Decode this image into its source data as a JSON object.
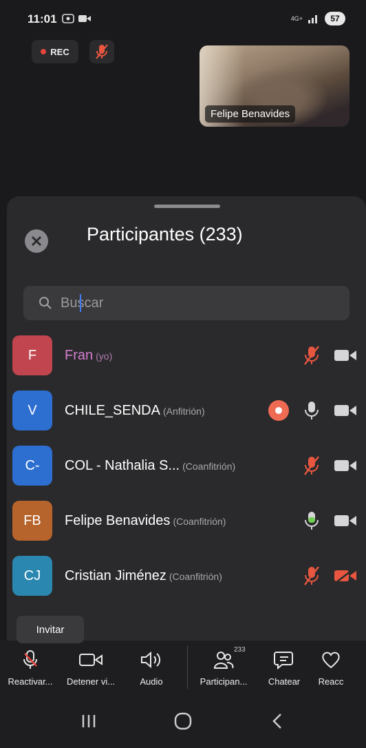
{
  "status_bar": {
    "time": "11:01",
    "battery": "57",
    "network": "4G+"
  },
  "meeting": {
    "rec_label": "REC",
    "video_tile_name": "Felipe Benavides"
  },
  "participants_panel": {
    "title": "Participantes (233)",
    "search_placeholder": "Buscar",
    "participants": [
      {
        "initials": "F",
        "name": "Fran",
        "role": "(yo)",
        "avatar_color": "#c0454f",
        "mic": "muted",
        "video": "on",
        "recording": false
      },
      {
        "initials": "V",
        "name": "CHILE_SENDA",
        "role": "(Anfitrión)",
        "avatar_color": "#2d6fd1",
        "mic": "on",
        "video": "on",
        "recording": true
      },
      {
        "initials": "C-",
        "name": "COL - Nathalia S...",
        "role": "(Coanfitrión)",
        "avatar_color": "#2d6fd1",
        "mic": "muted",
        "video": "on",
        "recording": false
      },
      {
        "initials": "FB",
        "name": "Felipe Benavides",
        "role": "(Coanfitrión)",
        "avatar_color": "#b7642c",
        "mic": "speaking",
        "video": "on",
        "recording": false
      },
      {
        "initials": "CJ",
        "name": "Cristian Jiménez",
        "role": "(Coanfitrión)",
        "avatar_color": "#2a87b0",
        "mic": "muted",
        "video": "off",
        "recording": false
      }
    ],
    "invite_label": "Invitar"
  },
  "toolbar": {
    "items": [
      {
        "label": "Reactivar...",
        "icon": "mic-muted-icon"
      },
      {
        "label": "Detener vi...",
        "icon": "video-camera-icon"
      },
      {
        "label": "Audio",
        "icon": "speaker-icon"
      },
      {
        "label": "Participan...",
        "icon": "participants-icon",
        "count": "233"
      },
      {
        "label": "Chatear",
        "icon": "chat-icon"
      },
      {
        "label": "Reacc",
        "icon": "heart-icon"
      }
    ]
  },
  "colors": {
    "accent_red": "#e8453c",
    "muted_red": "#e8563f",
    "speaking_green": "#6fcf52",
    "panel": "#2a2a2c"
  }
}
